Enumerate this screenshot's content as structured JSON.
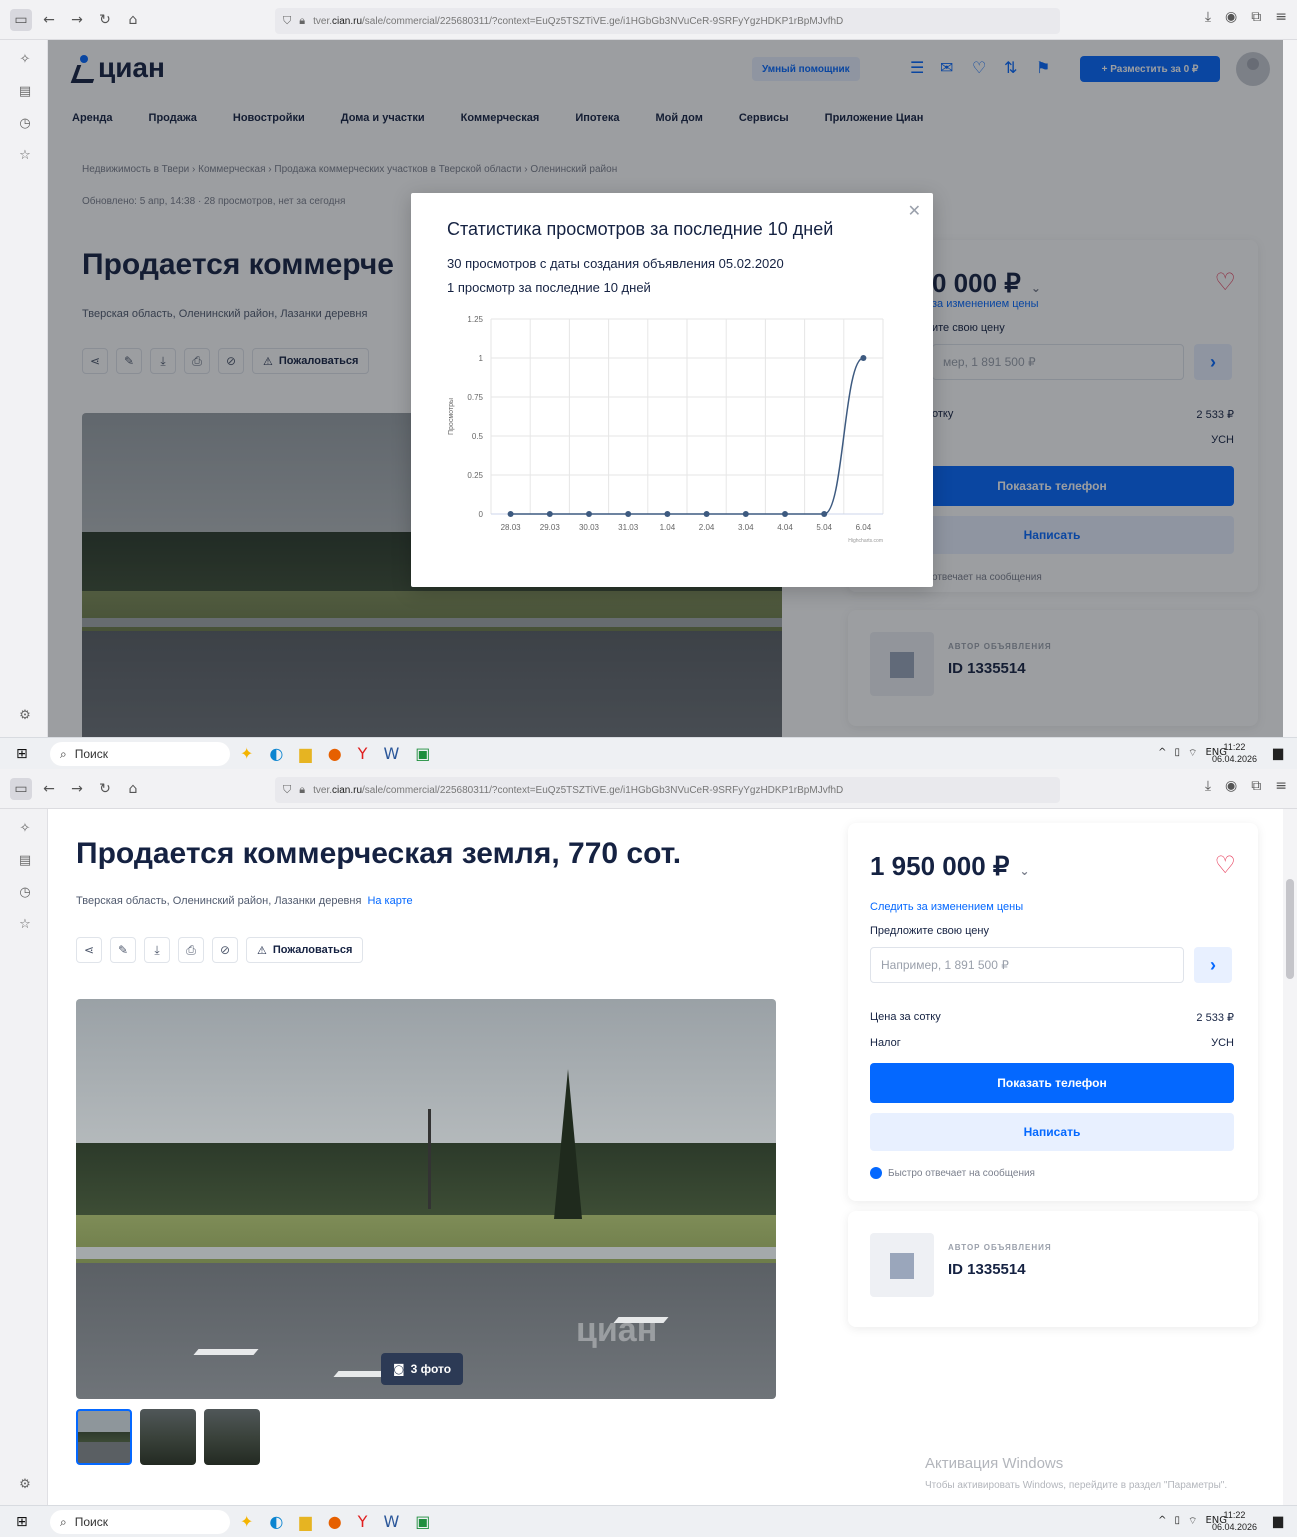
{
  "browser": {
    "url_prefix": "tver.",
    "url_domain": "cian.ru",
    "url_rest": "/sale/commercial/225680311/?context=EuQz5TSZTiVE.ge/i1HGbGb3NVuCeR-9SRFyYgzHDKP1rBpMJvfhD"
  },
  "header": {
    "logo": "циан",
    "smart_search": "Умный помощник",
    "post_button": "+ Разместить за 0 ₽"
  },
  "nav": [
    "Аренда",
    "Продажа",
    "Новостройки",
    "Дома и участки",
    "Коммерческая",
    "Ипотека",
    "Мой дом",
    "Сервисы",
    "Приложение Циан"
  ],
  "breadcrumbs": "Недвижимость в Твери  ›  Коммерческая  ›  Продажа коммерческих участков в Тверской области  ›  Оленинский район",
  "updated": "Обновлено: 5 апр, 14:38   ·  28 просмотров, нет за сегодня",
  "listing": {
    "title": "Продается коммерческая земля, 770 сот.",
    "title_short": "Продается коммерче",
    "address": "Тверская область, Оленинский район, Лазанки деревня",
    "map_link": "На карте",
    "complain": "Пожаловаться",
    "photos_badge": "3 фото",
    "watermark": "циан"
  },
  "price_card": {
    "price": "1 950 000 ₽",
    "price_short": "0 000 ₽",
    "follow": "Следить за изменением цены",
    "follow_short": "за изменением цены",
    "offer_label": "Предложите свою цену",
    "offer_label_short": "ите свою цену",
    "offer_placeholder": "Например, 1 891 500 ₽",
    "offer_placeholder_short": "мер, 1 891 500 ₽",
    "per_sotka_label": "Цена за сотку",
    "per_sotka_label_short": "отку",
    "per_sotka_value": "2 533 ₽",
    "tax_label": "Налог",
    "tax_value": "УСН",
    "show_phone": "Показать телефон",
    "write": "Написать",
    "fast_reply": "Быстро отвечает на сообщения",
    "fast_reply_short": "отвечает на сообщения"
  },
  "author": {
    "label": "АВТОР ОБЪЯВЛЕНИЯ",
    "id": "ID 1335514"
  },
  "modal": {
    "title": "Статистика просмотров за последние 10 дней",
    "line1": "30 просмотров с даты создания объявления 05.02.2020",
    "line2": "1 просмотр за последние 10 дней"
  },
  "chart_data": {
    "type": "line",
    "x": [
      "28.03",
      "29.03",
      "30.03",
      "31.03",
      "1.04",
      "2.04",
      "3.04",
      "4.04",
      "5.04",
      "6.04"
    ],
    "values": [
      0,
      0,
      0,
      0,
      0,
      0,
      0,
      0,
      0,
      1
    ],
    "ylabel": "Просмотры",
    "yticks": [
      "0",
      "0.25",
      "0.5",
      "0.75",
      "1",
      "1.25"
    ],
    "ylim": [
      0,
      1.25
    ],
    "grid": true,
    "credit": "Highcharts.com",
    "color": "#3d5a80"
  },
  "windows": {
    "activation": "Активация Windows",
    "activation_sub": "Чтобы активировать Windows, перейдите в раздел \"Параметры\"."
  },
  "taskbar": {
    "search": "Поиск",
    "lang": "ENG",
    "time": "11:22",
    "date": "06.04.2026"
  }
}
